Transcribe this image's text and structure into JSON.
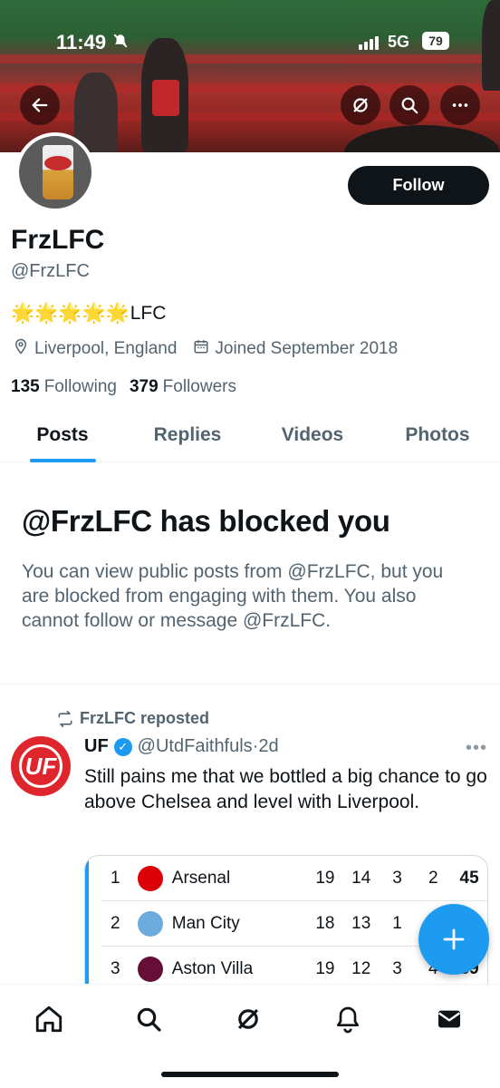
{
  "status_bar": {
    "time": "11:49",
    "network": "5G",
    "battery": "79"
  },
  "profile": {
    "name": "FrzLFC",
    "handle": "@FrzLFC",
    "bio_stars": "🌟🌟🌟🌟🌟",
    "bio_text": "LFC",
    "location": "Liverpool, England",
    "joined": "Joined September 2018",
    "following_count": "135",
    "following_label": "Following",
    "followers_count": "379",
    "followers_label": "Followers",
    "follow_button": "Follow"
  },
  "tabs": [
    {
      "label": "Posts",
      "active": true
    },
    {
      "label": "Replies",
      "active": false
    },
    {
      "label": "Videos",
      "active": false
    },
    {
      "label": "Photos",
      "active": false
    }
  ],
  "blocked": {
    "title": "@FrzLFC has blocked you",
    "body": "You can view public posts from @FrzLFC, but you are blocked from engaging with them. You also cannot follow or message @FrzLFC."
  },
  "tweet": {
    "repost_label": "FrzLFC reposted",
    "author_name": "UF",
    "author_handle": "@UtdFaithfuls",
    "time": "·2d",
    "avatar_text": "UF",
    "text": "Still pains me that we bottled a big chance to go above Chelsea and level with Liverpool.",
    "table": [
      {
        "pos": "1",
        "team": "Arsenal",
        "p": "19",
        "w": "14",
        "d": "3",
        "l": "2",
        "pts": "45",
        "color": "#db0007"
      },
      {
        "pos": "2",
        "team": "Man City",
        "p": "18",
        "w": "13",
        "d": "1",
        "l": "",
        "pts": "",
        "color": "#6cabdd"
      },
      {
        "pos": "3",
        "team": "Aston Villa",
        "p": "19",
        "w": "12",
        "d": "3",
        "l": "4",
        "pts": "39",
        "color": "#670e36"
      }
    ]
  },
  "icons": {
    "back": "arrow-left-icon",
    "grok": "grok-icon",
    "search": "search-icon",
    "more": "more-icon",
    "home": "home-icon",
    "bell": "bell-icon",
    "mail": "mail-icon",
    "compose": "plus-icon"
  },
  "colors": {
    "accent": "#1d9bf0",
    "text": "#0f1419",
    "muted": "#536471"
  }
}
